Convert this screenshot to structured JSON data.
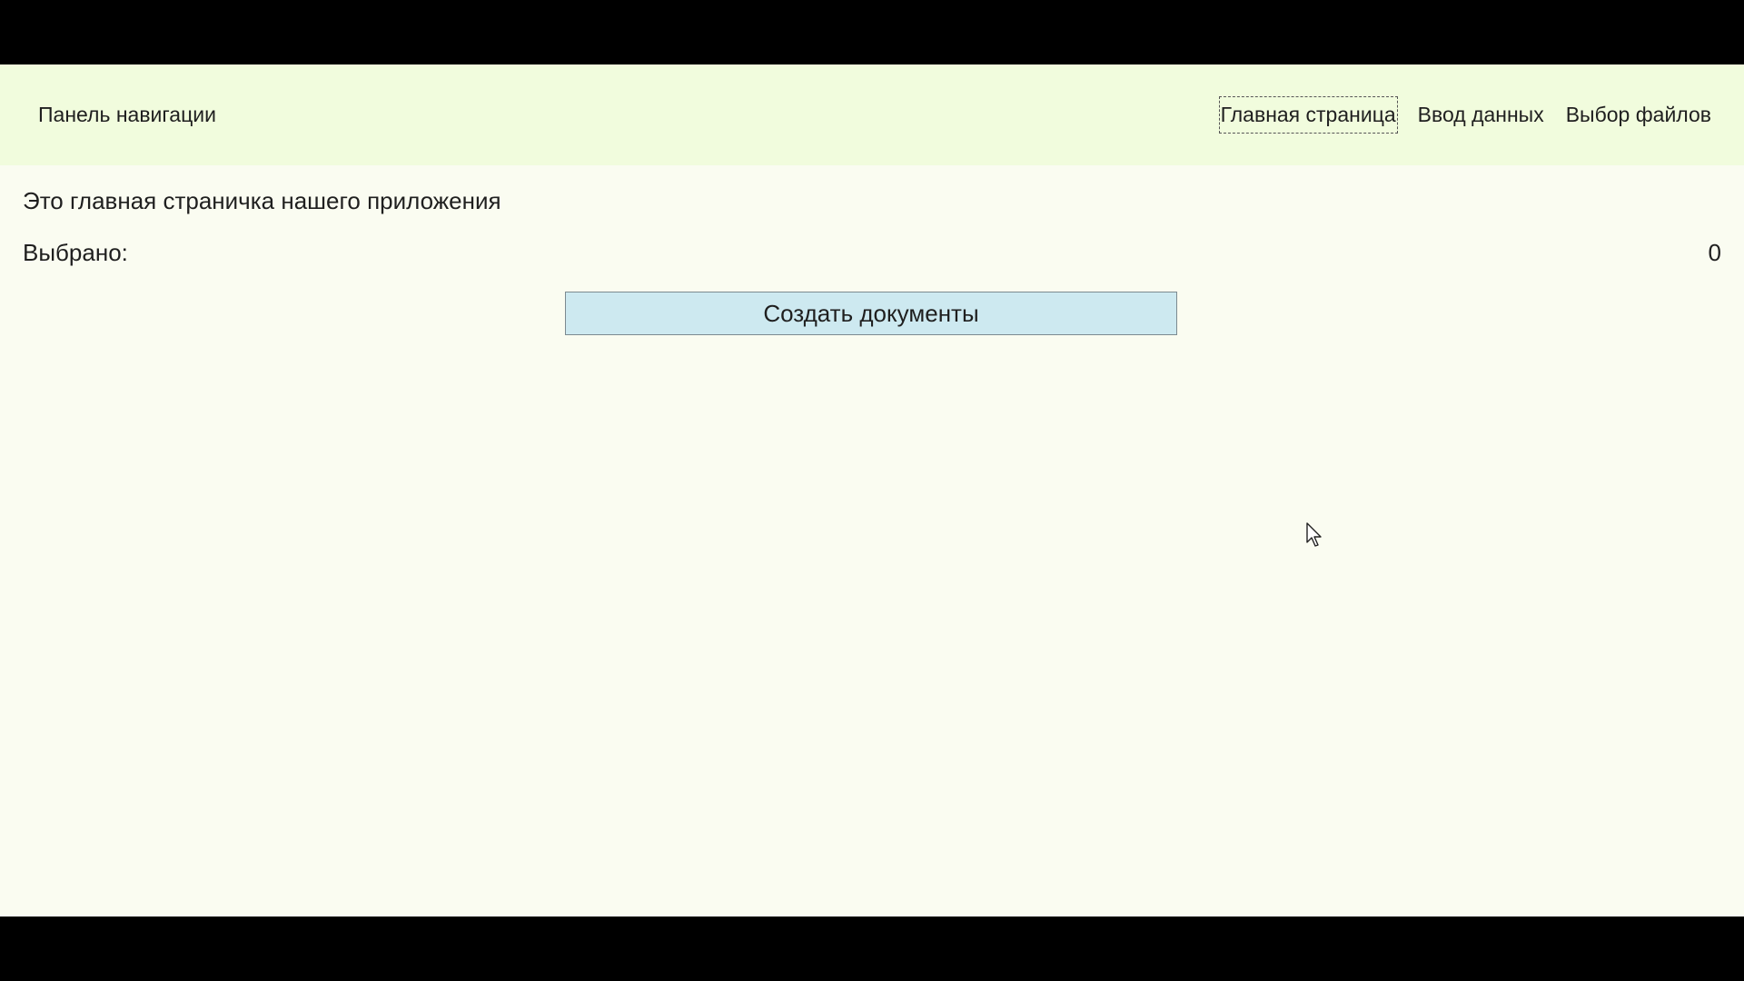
{
  "navbar": {
    "brand": "Панель навигации",
    "links": [
      {
        "label": "Главная страница",
        "active": true
      },
      {
        "label": "Ввод данных",
        "active": false
      },
      {
        "label": "Выбор файлов",
        "active": false
      }
    ]
  },
  "main": {
    "intro": "Это главная страничка нашего приложения",
    "selected_label": "Выбрано:",
    "selected_count": "0",
    "create_button_label": "Создать документы"
  },
  "colors": {
    "navbar_bg": "#f1fcdd",
    "page_bg": "#fafcf1",
    "button_bg": "#cde9f0",
    "letterbox": "#000000"
  },
  "icons": {
    "cursor": "mouse-pointer-icon"
  }
}
